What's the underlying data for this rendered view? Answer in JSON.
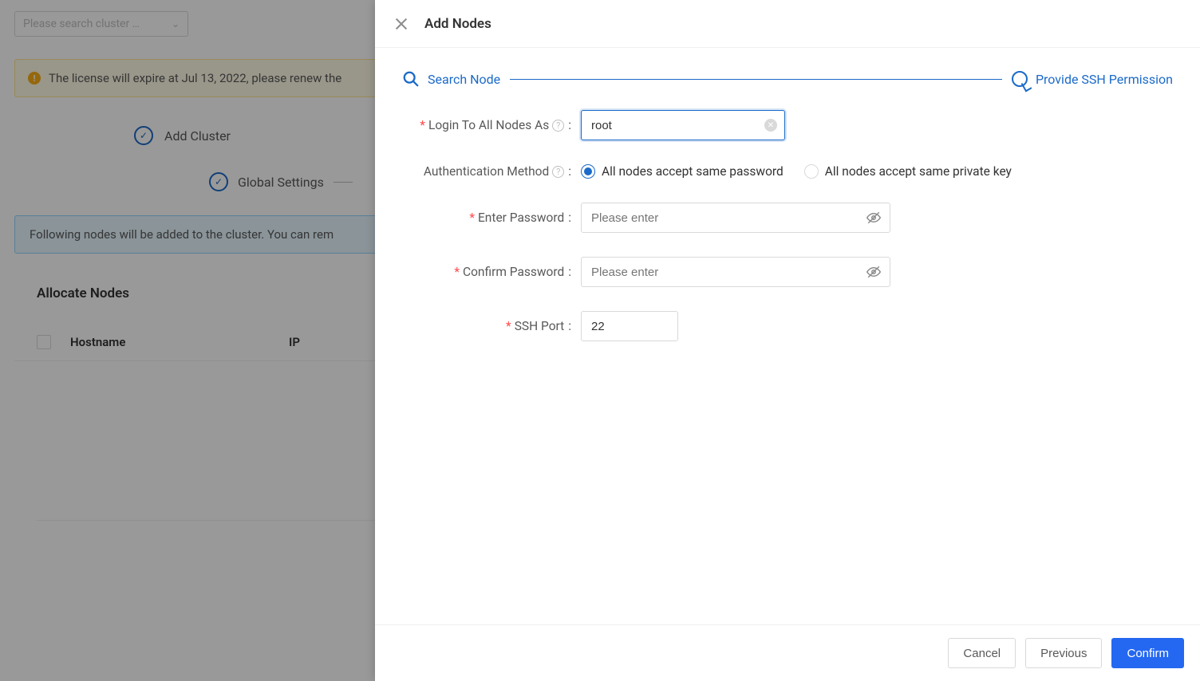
{
  "bg": {
    "search_placeholder": "Please search cluster …",
    "warning_text": "The license will expire at Jul 13, 2022, please renew the",
    "step_add_cluster": "Add Cluster",
    "step_global_settings": "Global Settings",
    "info_text": "Following nodes will be added to the cluster. You can rem",
    "allocate_title": "Allocate Nodes",
    "table": {
      "col_hostname": "Hostname",
      "col_ip": "IP"
    }
  },
  "drawer": {
    "title": "Add Nodes",
    "wizard": {
      "step1": "Search Node",
      "step2": "Provide SSH Permission"
    },
    "form": {
      "login_label": "Login To All Nodes As",
      "login_value": "root",
      "auth_label": "Authentication Method",
      "auth_option_password": "All nodes accept same password",
      "auth_option_key": "All nodes accept same private key",
      "enter_password_label": "Enter Password",
      "confirm_password_label": "Confirm Password",
      "password_placeholder": "Please enter",
      "ssh_port_label": "SSH Port",
      "ssh_port_value": "22"
    },
    "footer": {
      "cancel": "Cancel",
      "previous": "Previous",
      "confirm": "Confirm"
    }
  }
}
